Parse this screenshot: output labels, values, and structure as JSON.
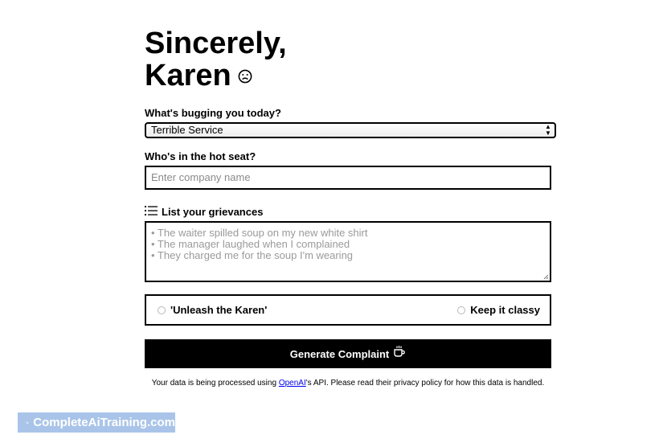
{
  "header": {
    "title_line1": "Sincerely,",
    "title_line2": "Karen",
    "title_icon": "frown-icon"
  },
  "issue": {
    "label": "What's bugging you today?",
    "selected": "Terrible Service"
  },
  "company": {
    "label": "Who's in the hot seat?",
    "placeholder": "Enter company name",
    "value": ""
  },
  "grievances": {
    "label": "List your grievances",
    "icon": "list-icon",
    "placeholder_lines": [
      "• The waiter spilled soup on my new white shirt",
      "• The manager laughed when I complained",
      "• They charged me for the soup I'm wearing"
    ]
  },
  "tone": {
    "option_left": "'Unleash the Karen'",
    "option_right": "Keep it classy",
    "selected": null
  },
  "actions": {
    "generate_label": "Generate Complaint",
    "generate_icon": "coffee-cup-icon"
  },
  "notice": {
    "before": "Your data is being processed using ",
    "link": "OpenAI",
    "after": "'s API. Please read their privacy policy for how this data is handled."
  },
  "brand": {
    "label": "CompleteAiTraining.com",
    "color": "#a9c4e8"
  }
}
